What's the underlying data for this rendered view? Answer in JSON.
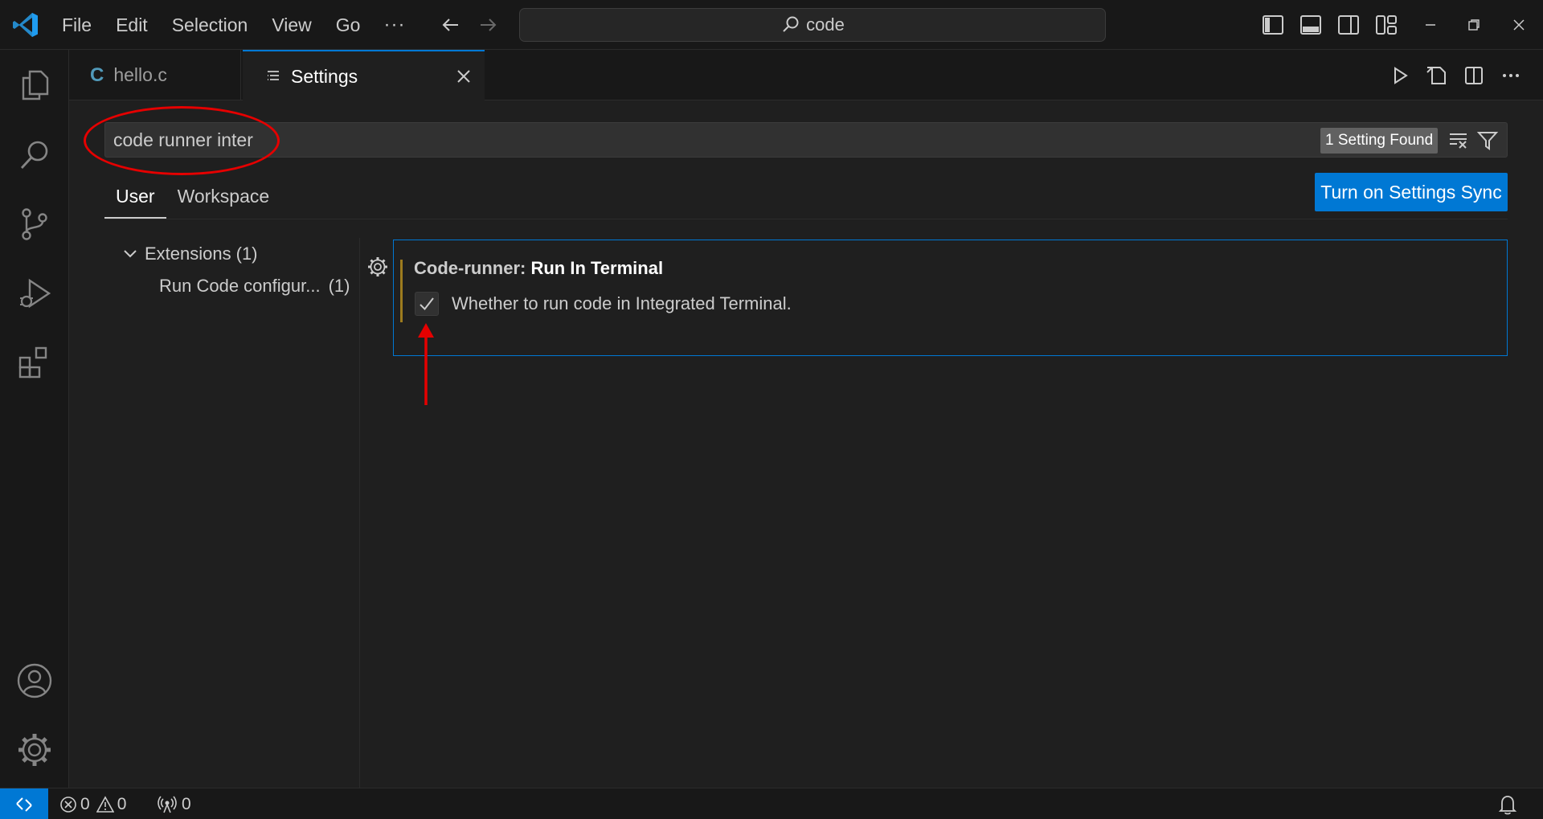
{
  "menu": {
    "items": [
      "File",
      "Edit",
      "Selection",
      "View",
      "Go"
    ],
    "more": "···"
  },
  "command_center": {
    "text": "code",
    "icon": "search-icon"
  },
  "tabs": [
    {
      "label": "hello.c",
      "icon_letter": "C",
      "icon": "c-file-icon",
      "active": false
    },
    {
      "label": "Settings",
      "icon": "settings-editor-icon",
      "active": true
    }
  ],
  "settings": {
    "search_value": "code runner inter",
    "found_badge": "1 Setting Found",
    "scope_tabs": [
      "User",
      "Workspace"
    ],
    "active_scope": "User",
    "sync_button": "Turn on Settings Sync",
    "toc": {
      "extensions_label": "Extensions",
      "extensions_count": "(1)",
      "sub_label": "Run Code configur...",
      "sub_count": "(1)"
    },
    "setting": {
      "category": "Code-runner: ",
      "name": "Run In Terminal",
      "description": "Whether to run code in Integrated Terminal.",
      "checked": true
    }
  },
  "status": {
    "errors": "0",
    "warnings": "0",
    "ports": "0"
  },
  "colors": {
    "accent": "#0078d4",
    "annotation": "#e50000",
    "modified_bar": "#9d7b1e"
  }
}
